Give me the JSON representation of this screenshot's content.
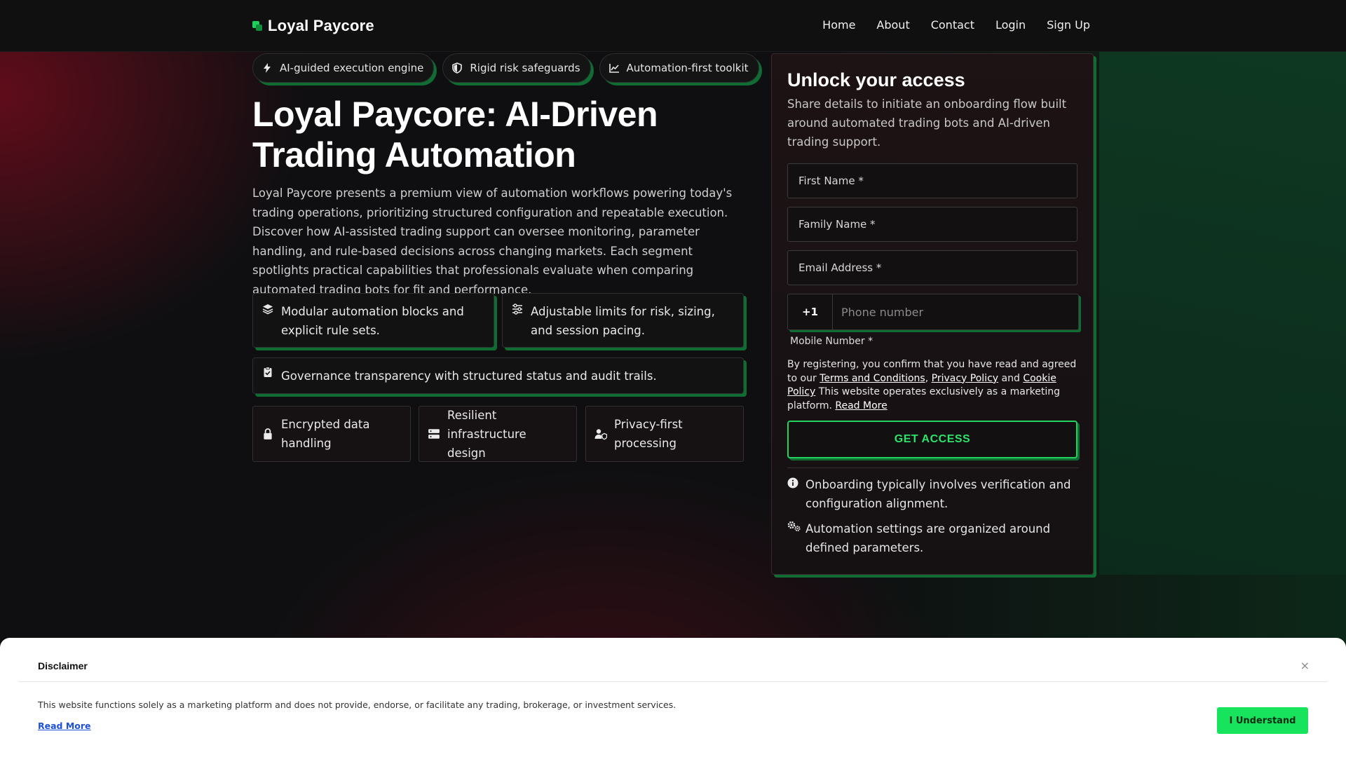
{
  "header": {
    "brand": "Loyal Paycore",
    "nav": [
      "Home",
      "About",
      "Contact",
      "Login",
      "Sign Up"
    ]
  },
  "badges": [
    {
      "icon": "bolt-icon",
      "label": "AI-guided execution engine"
    },
    {
      "icon": "shield-icon",
      "label": "Rigid risk safeguards"
    },
    {
      "icon": "chart-line-icon",
      "label": "Automation-first toolkit"
    }
  ],
  "hero": {
    "title": "Loyal Paycore: AI-Driven Trading Automation",
    "description": "Loyal Paycore presents a premium view of automation workflows powering today's trading operations, prioritizing structured configuration and repeatable execution. Discover how AI-assisted trading support can oversee monitoring, parameter handling, and rule-based decisions across changing markets. Each segment spotlights practical capabilities that professionals evaluate when comparing automated trading bots for fit and performance."
  },
  "features": [
    {
      "icon": "layers-icon",
      "text": "Modular automation blocks and explicit rule sets."
    },
    {
      "icon": "sliders-icon",
      "text": "Adjustable limits for risk, sizing, and session pacing."
    },
    {
      "icon": "clipboard-check-icon",
      "text": "Governance transparency with structured status and audit trails."
    }
  ],
  "security": [
    {
      "icon": "lock-icon",
      "text": "Encrypted data handling"
    },
    {
      "icon": "server-icon",
      "text": "Resilient infrastructure design"
    },
    {
      "icon": "user-shield-icon",
      "text": "Privacy-first processing"
    }
  ],
  "form": {
    "title": "Unlock your access",
    "subtitle": "Share details to initiate an onboarding flow built around automated trading bots and AI-driven trading support.",
    "first_name_placeholder": "First Name *",
    "family_name_placeholder": "Family Name *",
    "email_placeholder": "Email Address *",
    "phone_code": "+1",
    "phone_placeholder": "Phone number",
    "mobile_label": "Mobile Number *",
    "legal_prefix": "By registering, you confirm that you have read and agreed to our",
    "terms_link": "Terms and Conditions",
    "privacy_link": "Privacy Policy",
    "and_text": "and",
    "cookie_link": "Cookie Policy",
    "legal_suffix": "This website operates exclusively as a marketing platform.",
    "read_more": "Read More",
    "cta": "GET ACCESS",
    "notes": [
      {
        "icon": "info-icon",
        "text": "Onboarding typically involves verification and configuration alignment."
      },
      {
        "icon": "gears-icon",
        "text": "Automation settings are organized around defined parameters."
      }
    ]
  },
  "disclaimer": {
    "title": "Disclaimer",
    "close": "×",
    "text": "This website functions solely as a marketing platform and does not provide, endorse, or facilitate any trading, brokerage, or investment services.",
    "read_more": "Read More",
    "button": "I Understand"
  },
  "colors": {
    "accent": "#22d45e",
    "shadow_green": "#0f6d33",
    "background": "#0f0f11"
  }
}
